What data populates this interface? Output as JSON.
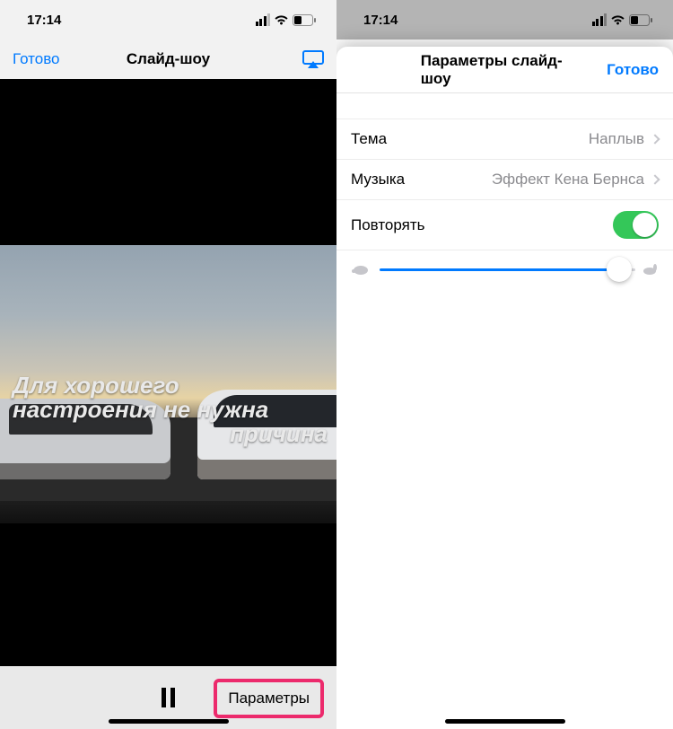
{
  "status": {
    "time": "17:14"
  },
  "left": {
    "nav": {
      "done": "Готово",
      "title": "Слайд-шоу"
    },
    "overlay": {
      "line1": "Для хорошего",
      "line2": "настроения не нужна",
      "line3": "причина"
    },
    "toolbar": {
      "options": "Параметры"
    }
  },
  "right": {
    "nav": {
      "title": "Параметры слайд-шоу",
      "done": "Готово"
    },
    "rows": {
      "theme": {
        "label": "Тема",
        "value": "Наплыв"
      },
      "music": {
        "label": "Музыка",
        "value": "Эффект Кена Бернса"
      },
      "repeat": {
        "label": "Повторять",
        "on": true
      }
    },
    "slider": {
      "value": 0.97
    }
  }
}
